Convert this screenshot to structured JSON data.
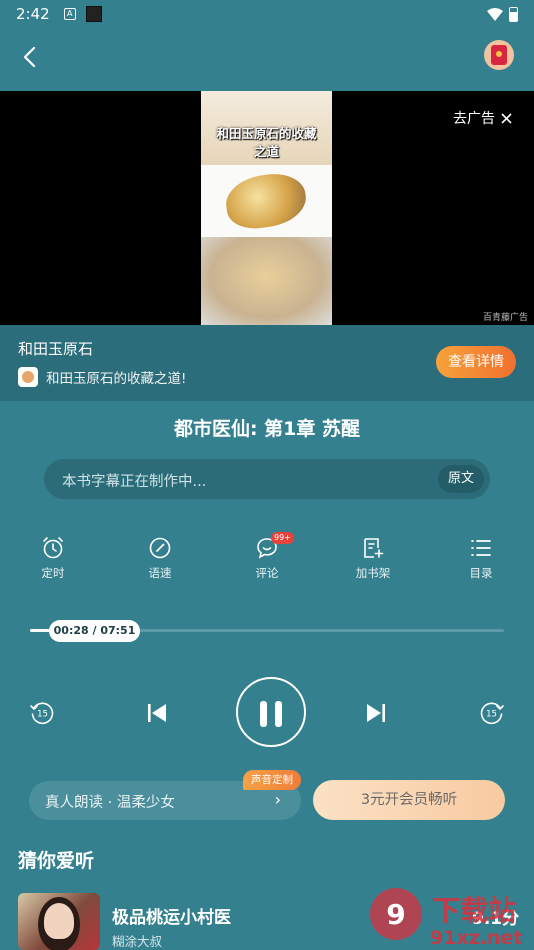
{
  "status_bar": {
    "time": "2:42"
  },
  "ad": {
    "frame_caption_line1": "和田玉原石的收藏",
    "frame_caption_line2": "之道",
    "skip_label": "去广告",
    "source": "百青藤广告",
    "title": "和田玉原石",
    "subtitle": "和田玉原石的收藏之道!",
    "detail_button": "查看详情"
  },
  "player": {
    "chapter_title": "都市医仙: 第1章 苏醒",
    "subtitle_placeholder": "本书字幕正在制作中...",
    "original_button": "原文",
    "tools": [
      {
        "label": "定时",
        "icon": "alarm-clock-icon"
      },
      {
        "label": "语速",
        "icon": "speed-gauge-icon"
      },
      {
        "label": "评论",
        "icon": "comment-icon",
        "badge": "99+"
      },
      {
        "label": "加书架",
        "icon": "add-bookshelf-icon"
      },
      {
        "label": "目录",
        "icon": "catalog-list-icon"
      }
    ],
    "progress_label": "00:28 / 07:51",
    "progress_fraction": 0.06,
    "rewind_seconds": "15",
    "forward_seconds": "15"
  },
  "voice": {
    "label": "真人朗读 · 温柔少女",
    "tag": "声音定制",
    "vip_button": "3元开会员畅听"
  },
  "recommend": {
    "title": "猜你爱听",
    "items": [
      {
        "title": "极品桃运小村医",
        "author": "糊涂大叔",
        "score": "9.1分"
      }
    ]
  },
  "watermark": {
    "brand": "下载站",
    "url": "91xz.net"
  },
  "colors": {
    "background": "#34808f",
    "accent": "#f0702f"
  }
}
